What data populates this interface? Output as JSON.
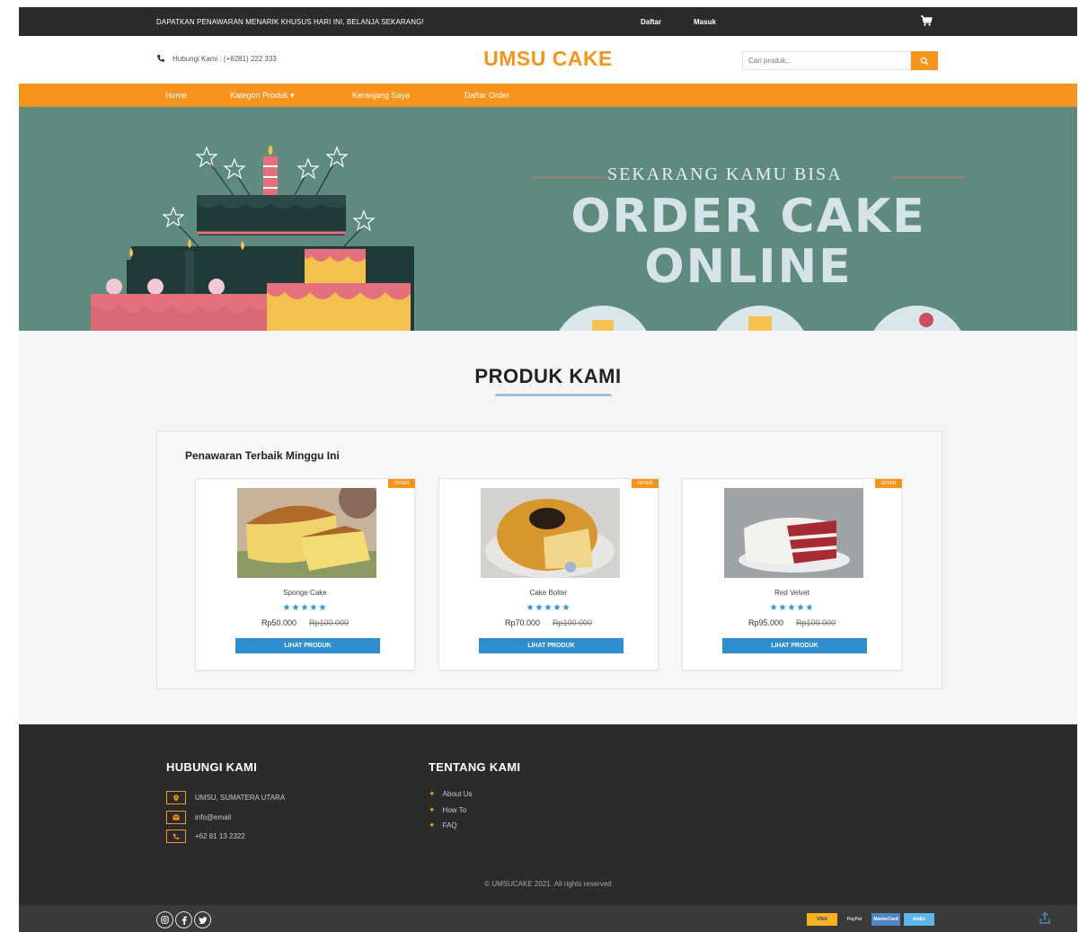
{
  "topbar": {
    "promo": "DAPATKAN PENAWARAN MENARIK KHUSUS HARI INI, BELANJA SEKARANG!",
    "daftar": "Daftar",
    "masuk": "Masuk",
    "cart_icon": "cart-icon"
  },
  "header": {
    "phone": "Hubungi Kami : (+6281) 222 333",
    "brand": "UMSU CAKE",
    "search_placeholder": "Cari produk..."
  },
  "nav": {
    "items": [
      "Home",
      "Kategori Produk ▾",
      "Keranjang Saya",
      "Daftar Order"
    ]
  },
  "banner": {
    "subtitle": "SEKARANG KAMU BISA",
    "line1": "ORDER CAKE",
    "line2": "ONLINE",
    "bg_color": "#5f8a80"
  },
  "products": {
    "title": "PRODUK KAMI",
    "box_title": "Penawaran Terbaik Minggu Ini",
    "items": [
      {
        "badge": "OFFER",
        "name": "Sponge Cake",
        "stars": "★★★★★",
        "price": "Rp50.000",
        "old_price": "Rp100.000",
        "button": "LIHAT PRODUK"
      },
      {
        "badge": "OFFER",
        "name": "Cake Bolter",
        "stars": "★★★★★",
        "price": "Rp70.000",
        "old_price": "Rp100.000",
        "button": "LIHAT PRODUK"
      },
      {
        "badge": "OFFER",
        "name": "Red Velvet",
        "stars": "★★★★★",
        "price": "Rp95.000",
        "old_price": "Rp100.000",
        "button": "LIHAT PRODUK"
      }
    ]
  },
  "footer": {
    "contact_title": "HUBUNGI KAMI",
    "about_title": "TENTANG KAMI",
    "contacts": [
      {
        "icon": "location-icon",
        "text": "UMSU, SUMATERA UTARA"
      },
      {
        "icon": "email-icon",
        "text": "info@email"
      },
      {
        "icon": "phone-icon",
        "text": "+62 81 13 2322"
      }
    ],
    "links": [
      "About Us",
      "How To",
      "FAQ"
    ],
    "copyright": "© UMSUCAKE 2021. All rights reserved"
  },
  "bottom": {
    "social": [
      "instagram-icon",
      "facebook-icon",
      "twitter-icon"
    ],
    "payments": [
      "VISA",
      "PayPal",
      "MasterCard",
      "AmEx"
    ]
  },
  "colors": {
    "accent": "#f7941d",
    "dark": "#2b2b2b",
    "blue": "#2d8fd0"
  }
}
